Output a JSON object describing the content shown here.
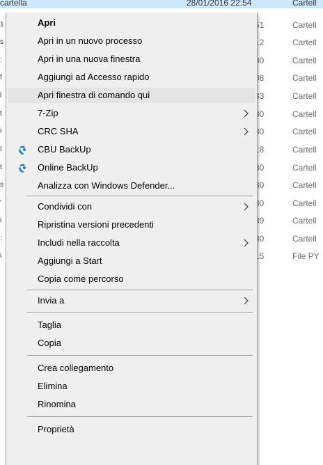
{
  "background": {
    "top_text_left": "cartella",
    "top_text_mid": "28/01/2016 22:54",
    "top_type": "Cartell",
    "rows": [
      {
        "left": "1",
        "time": "51",
        "type": "Cartell"
      },
      {
        "left": "s",
        "time": "12",
        "type": "Cartell"
      },
      {
        "left": ":",
        "time": "30",
        "type": "Cartell"
      },
      {
        "left": "f",
        "time": "08",
        "type": "Cartell"
      },
      {
        "left": "l",
        "time": "33",
        "type": "Cartell"
      },
      {
        "left": "t",
        "time": "30",
        "type": "Cartell"
      },
      {
        "left": "i",
        "time": "30",
        "type": "Cartell"
      },
      {
        "left": "I",
        "time": "18",
        "type": "Cartell"
      },
      {
        "left": "t",
        "time": "30",
        "type": "Cartell"
      },
      {
        "left": "s",
        "time": "30",
        "type": "Cartell"
      },
      {
        "left": "'",
        "time": "30",
        "type": "Cartell"
      },
      {
        "left": "i",
        "time": "39",
        "type": "Cartell"
      },
      {
        "left": ":",
        "time": "30",
        "type": "Cartell"
      },
      {
        "left": "i",
        "time": "15",
        "type": "File PY"
      }
    ]
  },
  "menu": {
    "items": [
      {
        "label": "Apri",
        "bold": true
      },
      {
        "label": "Apri in un nuovo processo"
      },
      {
        "label": "Apri in una nuova finestra"
      },
      {
        "label": "Aggiungi ad Accesso rapido"
      },
      {
        "label": "Apri finestra di comando qui",
        "highlighted": true
      },
      {
        "label": "7-Zip",
        "submenu": true
      },
      {
        "label": "CRC SHA",
        "submenu": true
      },
      {
        "label": "CBU BackUp",
        "icon": "backup-icon"
      },
      {
        "label": "Online BackUp",
        "icon": "backup-icon"
      },
      {
        "label": "Analizza con Windows Defender..."
      },
      {
        "label": "Condividi con",
        "submenu": true
      },
      {
        "label": "Ripristina versioni precedenti"
      },
      {
        "label": "Includi nella raccolta",
        "submenu": true
      },
      {
        "label": "Aggiungi a Start"
      },
      {
        "label": "Copia come percorso"
      },
      {
        "label": "Invia a",
        "submenu": true
      },
      {
        "label": "Taglia"
      },
      {
        "label": "Copia"
      },
      {
        "label": "Crea collegamento"
      },
      {
        "label": "Elimina"
      },
      {
        "label": "Rinomina"
      },
      {
        "label": "Proprietà"
      }
    ]
  },
  "colors": {
    "menu_bg": "#f0f0f0",
    "highlight": "#e5e5e5",
    "selection_strip": "#cce8ff",
    "separator": "#a0a0a0",
    "icon_blue": "#1e7fd6"
  }
}
